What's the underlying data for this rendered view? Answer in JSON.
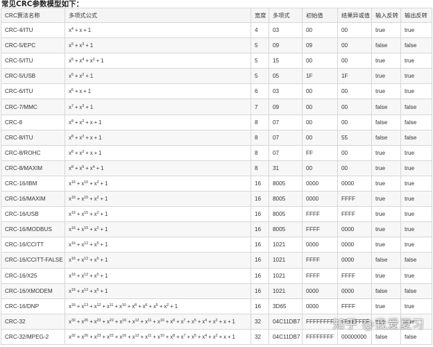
{
  "heading": "常见CRC参数模型如下：",
  "columns": [
    "CRC算法名称",
    "多项式公式",
    "宽度",
    "多项式",
    "初始值",
    "结果异或值",
    "输入反转",
    "输出反转"
  ],
  "rows": [
    {
      "name": "CRC-4/ITU",
      "poly": [
        [
          "x",
          "4"
        ],
        [
          "x",
          ""
        ],
        [
          "1",
          ""
        ]
      ],
      "width": "4",
      "hex": "03",
      "init": "00",
      "xorout": "00",
      "refin": "true",
      "refout": "true"
    },
    {
      "name": "CRC-5/EPC",
      "poly": [
        [
          "x",
          "5"
        ],
        [
          "x",
          "3"
        ],
        [
          "1",
          ""
        ]
      ],
      "width": "5",
      "hex": "09",
      "init": "09",
      "xorout": "00",
      "refin": "false",
      "refout": "false"
    },
    {
      "name": "CRC-5/ITU",
      "poly": [
        [
          "x",
          "5"
        ],
        [
          "x",
          "4"
        ],
        [
          "x",
          "2"
        ],
        [
          "1",
          ""
        ]
      ],
      "width": "5",
      "hex": "15",
      "init": "00",
      "xorout": "00",
      "refin": "true",
      "refout": "true"
    },
    {
      "name": "CRC-5/USB",
      "poly": [
        [
          "x",
          "5"
        ],
        [
          "x",
          "2"
        ],
        [
          "1",
          ""
        ]
      ],
      "width": "5",
      "hex": "05",
      "init": "1F",
      "xorout": "1F",
      "refin": "true",
      "refout": "true"
    },
    {
      "name": "CRC-6/ITU",
      "poly": [
        [
          "x",
          "6"
        ],
        [
          "x",
          ""
        ],
        [
          "1",
          ""
        ]
      ],
      "width": "6",
      "hex": "03",
      "init": "00",
      "xorout": "00",
      "refin": "true",
      "refout": "true"
    },
    {
      "name": "CRC-7/MMC",
      "poly": [
        [
          "x",
          "7"
        ],
        [
          "x",
          "3"
        ],
        [
          "1",
          ""
        ]
      ],
      "width": "7",
      "hex": "09",
      "init": "00",
      "xorout": "00",
      "refin": "false",
      "refout": "false"
    },
    {
      "name": "CRC-8",
      "poly": [
        [
          "x",
          "8"
        ],
        [
          "x",
          "2"
        ],
        [
          "x",
          ""
        ],
        [
          "1",
          ""
        ]
      ],
      "width": "8",
      "hex": "07",
      "init": "00",
      "xorout": "00",
      "refin": "false",
      "refout": "false"
    },
    {
      "name": "CRC-8/ITU",
      "poly": [
        [
          "x",
          "8"
        ],
        [
          "x",
          "2"
        ],
        [
          "x",
          ""
        ],
        [
          "1",
          ""
        ]
      ],
      "width": "8",
      "hex": "07",
      "init": "00",
      "xorout": "55",
      "refin": "false",
      "refout": "false"
    },
    {
      "name": "CRC-8/ROHC",
      "poly": [
        [
          "x",
          "8"
        ],
        [
          "x",
          "2"
        ],
        [
          "x",
          ""
        ],
        [
          "1",
          ""
        ]
      ],
      "width": "8",
      "hex": "07",
      "init": "FF",
      "xorout": "00",
      "refin": "true",
      "refout": "true"
    },
    {
      "name": "CRC-8/MAXIM",
      "poly": [
        [
          "x",
          "8"
        ],
        [
          "x",
          "5"
        ],
        [
          "x",
          "4"
        ],
        [
          "1",
          ""
        ]
      ],
      "width": "8",
      "hex": "31",
      "init": "00",
      "xorout": "00",
      "refin": "true",
      "refout": "true"
    },
    {
      "name": "CRC-16/IBM",
      "poly": [
        [
          "x",
          "16"
        ],
        [
          "x",
          "15"
        ],
        [
          "x",
          "2"
        ],
        [
          "1",
          ""
        ]
      ],
      "width": "16",
      "hex": "8005",
      "init": "0000",
      "xorout": "0000",
      "refin": "true",
      "refout": "true"
    },
    {
      "name": "CRC-16/MAXIM",
      "poly": [
        [
          "x",
          "16"
        ],
        [
          "x",
          "15"
        ],
        [
          "x",
          "2"
        ],
        [
          "1",
          ""
        ]
      ],
      "width": "16",
      "hex": "8005",
      "init": "0000",
      "xorout": "FFFF",
      "refin": "true",
      "refout": "true"
    },
    {
      "name": "CRC-16/USB",
      "poly": [
        [
          "x",
          "16"
        ],
        [
          "x",
          "15"
        ],
        [
          "x",
          "2"
        ],
        [
          "1",
          ""
        ]
      ],
      "width": "16",
      "hex": "8005",
      "init": "FFFF",
      "xorout": "FFFF",
      "refin": "true",
      "refout": "true"
    },
    {
      "name": "CRC-16/MODBUS",
      "poly": [
        [
          "x",
          "16"
        ],
        [
          "x",
          "15"
        ],
        [
          "x",
          "2"
        ],
        [
          "1",
          ""
        ]
      ],
      "width": "16",
      "hex": "8005",
      "init": "FFFF",
      "xorout": "0000",
      "refin": "true",
      "refout": "true"
    },
    {
      "name": "CRC-16/CCITT",
      "poly": [
        [
          "x",
          "16"
        ],
        [
          "x",
          "12"
        ],
        [
          "x",
          "5"
        ],
        [
          "1",
          ""
        ]
      ],
      "width": "16",
      "hex": "1021",
      "init": "0000",
      "xorout": "0000",
      "refin": "true",
      "refout": "true"
    },
    {
      "name": "CRC-16/CCITT-FALSE",
      "poly": [
        [
          "x",
          "16"
        ],
        [
          "x",
          "12"
        ],
        [
          "x",
          "5"
        ],
        [
          "1",
          ""
        ]
      ],
      "width": "16",
      "hex": "1021",
      "init": "FFFF",
      "xorout": "0000",
      "refin": "false",
      "refout": "false"
    },
    {
      "name": "CRC-16/X25",
      "poly": [
        [
          "x",
          "16"
        ],
        [
          "x",
          "12"
        ],
        [
          "x",
          "5"
        ],
        [
          "1",
          ""
        ]
      ],
      "width": "16",
      "hex": "1021",
      "init": "FFFF",
      "xorout": "FFFF",
      "refin": "true",
      "refout": "true"
    },
    {
      "name": "CRC-16/XMODEM",
      "poly": [
        [
          "x",
          "16"
        ],
        [
          "x",
          "12"
        ],
        [
          "x",
          "5"
        ],
        [
          "1",
          ""
        ]
      ],
      "width": "16",
      "hex": "1021",
      "init": "0000",
      "xorout": "0000",
      "refin": "false",
      "refout": "false"
    },
    {
      "name": "CRC-16/DNP",
      "poly": [
        [
          "x",
          "16"
        ],
        [
          "x",
          "13"
        ],
        [
          "x",
          "12"
        ],
        [
          "x",
          "11"
        ],
        [
          "x",
          "10"
        ],
        [
          "x",
          "8"
        ],
        [
          "x",
          "6"
        ],
        [
          "x",
          "5"
        ],
        [
          "x",
          "2"
        ],
        [
          "1",
          ""
        ]
      ],
      "width": "16",
      "hex": "3D65",
      "init": "0000",
      "xorout": "FFFF",
      "refin": "true",
      "refout": "true"
    },
    {
      "name": "CRC-32",
      "poly": [
        [
          "x",
          "32"
        ],
        [
          "x",
          "26"
        ],
        [
          "x",
          "23"
        ],
        [
          "x",
          "22"
        ],
        [
          "x",
          "16"
        ],
        [
          "x",
          "12"
        ],
        [
          "x",
          "11"
        ],
        [
          "x",
          "10"
        ],
        [
          "x",
          "8"
        ],
        [
          "x",
          "7"
        ],
        [
          "x",
          "5"
        ],
        [
          "x",
          "4"
        ],
        [
          "x",
          "2"
        ],
        [
          "x",
          ""
        ],
        [
          "1",
          ""
        ]
      ],
      "width": "32",
      "hex": "04C11DB7",
      "init": "FFFFFFFF",
      "xorout": "FFFFFFFF",
      "refin": "true",
      "refout": "true"
    },
    {
      "name": "CRC-32/MPEG-2",
      "poly": [
        [
          "x",
          "32"
        ],
        [
          "x",
          "26"
        ],
        [
          "x",
          "23"
        ],
        [
          "x",
          "22"
        ],
        [
          "x",
          "16"
        ],
        [
          "x",
          "12"
        ],
        [
          "x",
          "11"
        ],
        [
          "x",
          "10"
        ],
        [
          "x",
          "8"
        ],
        [
          "x",
          "7"
        ],
        [
          "x",
          "5"
        ],
        [
          "x",
          "4"
        ],
        [
          "x",
          "2"
        ],
        [
          "x",
          ""
        ],
        [
          "1",
          ""
        ]
      ],
      "width": "32",
      "hex": "04C11DB7",
      "init": "FFFFFFFF",
      "xorout": "00000000",
      "refin": "false",
      "refout": "false"
    }
  ],
  "watermark": "知乎 @我爱夏习"
}
